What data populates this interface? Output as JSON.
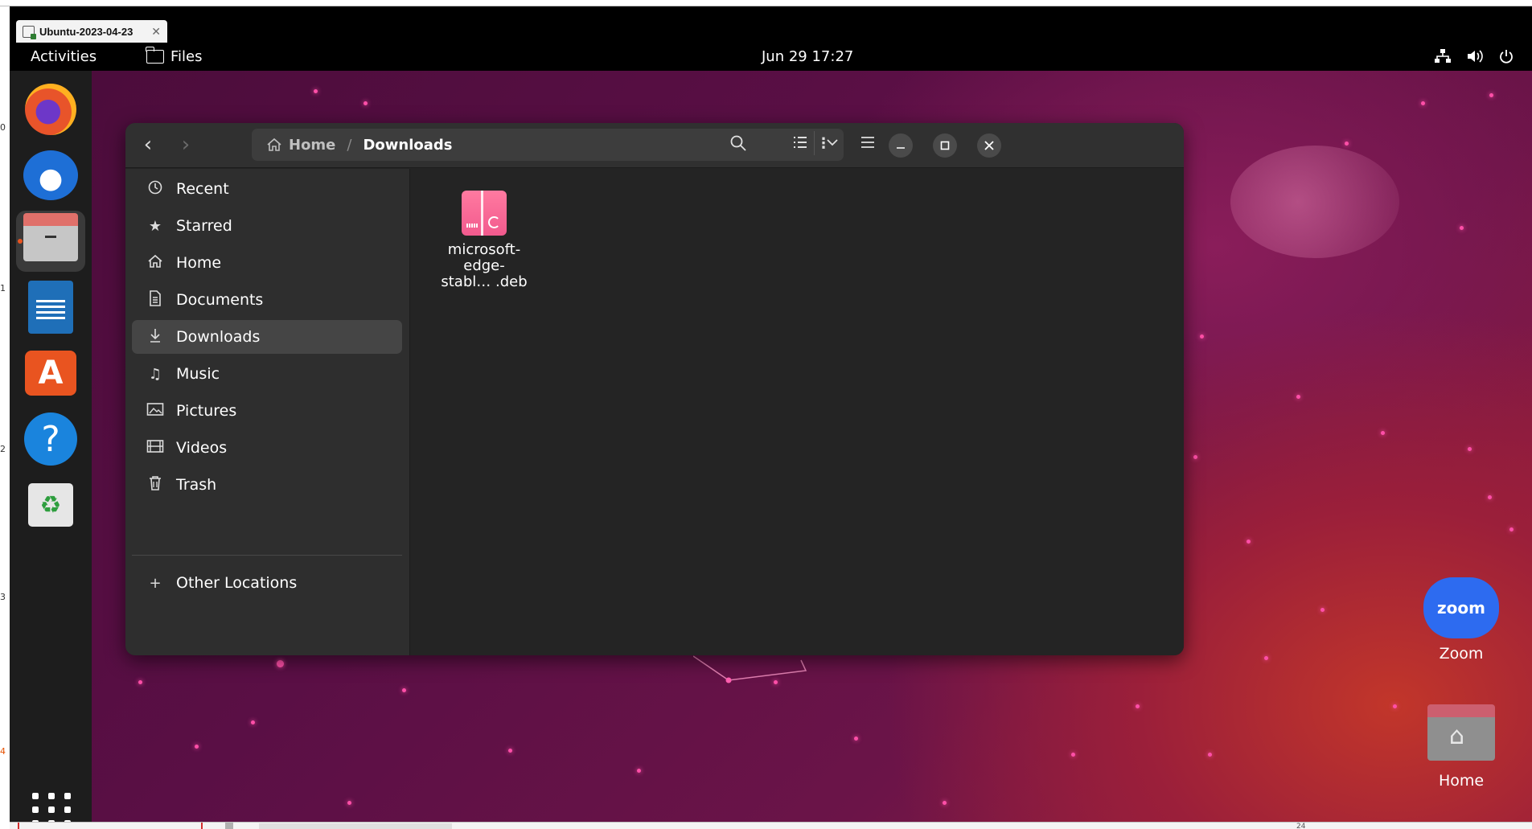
{
  "host": {
    "tab_title": "Ubuntu-2023-04-23",
    "tab_close": "✕",
    "ruler_numbers": [
      "0",
      "1",
      "2",
      "3",
      "4"
    ],
    "bottom_text": "24"
  },
  "topbar": {
    "activities": "Activities",
    "app_name": "Files",
    "clock": "Jun 29  17:27",
    "tray_icons": [
      "network-icon",
      "volume-icon",
      "power-icon"
    ]
  },
  "dock": {
    "apps": [
      "Firefox",
      "Thunderbird",
      "Files",
      "LibreOffice Writer",
      "Ubuntu Software",
      "Help",
      "Trash"
    ],
    "active_app": "Files",
    "accent": "#e95420"
  },
  "window": {
    "pathbar": {
      "home": "Home",
      "separator": "/",
      "current": "Downloads",
      "menu": "⋮"
    },
    "sidebar": {
      "items": [
        {
          "label": "Recent",
          "icon": "clock-icon"
        },
        {
          "label": "Starred",
          "icon": "star-icon"
        },
        {
          "label": "Home",
          "icon": "home-icon"
        },
        {
          "label": "Documents",
          "icon": "document-icon"
        },
        {
          "label": "Downloads",
          "icon": "download-icon",
          "selected": true
        },
        {
          "label": "Music",
          "icon": "music-icon"
        },
        {
          "label": "Pictures",
          "icon": "picture-icon"
        },
        {
          "label": "Videos",
          "icon": "video-icon"
        },
        {
          "label": "Trash",
          "icon": "trash-icon"
        }
      ],
      "other_locations": "Other Locations"
    },
    "files": [
      {
        "name": "microsoft-\nedge-\nstabl… .deb",
        "icon": "deb-package-icon"
      }
    ]
  },
  "desktop": {
    "icons": [
      {
        "label": "Zoom",
        "logo_text": "zoom"
      },
      {
        "label": "Home"
      }
    ]
  }
}
